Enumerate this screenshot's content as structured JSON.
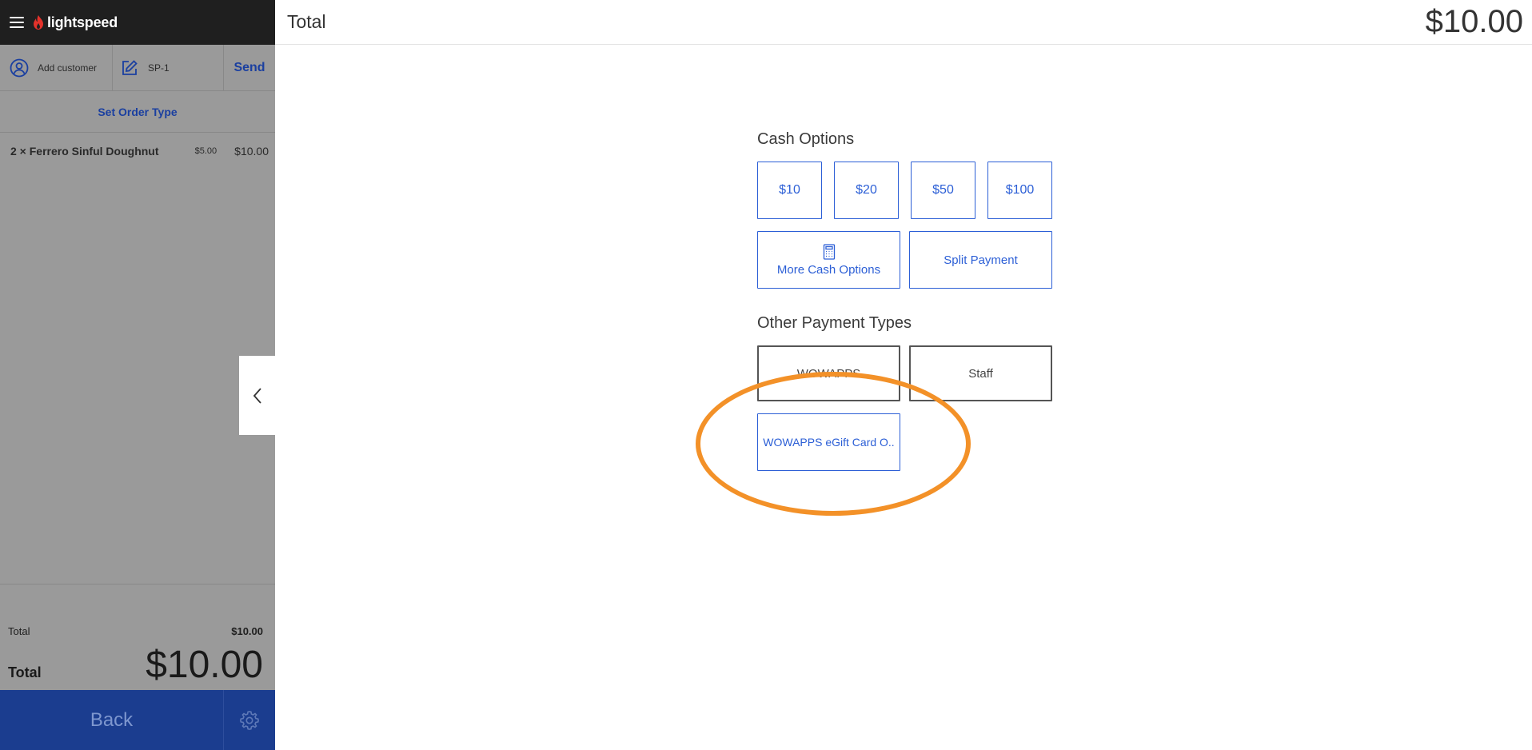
{
  "app": {
    "brand": "lightspeed"
  },
  "customer_bar": {
    "add_customer_label": "Add customer",
    "order_ref": "SP-1",
    "send_label": "Send"
  },
  "order_type_label": "Set Order Type",
  "line_items": [
    {
      "name": "2 × Ferrero Sinful Doughnut",
      "unit_price": "$5.00",
      "total": "$10.00"
    }
  ],
  "summary": {
    "subtotal_label": "Total",
    "subtotal_value": "$10.00",
    "total_label": "Total",
    "total_value": "$10.00"
  },
  "bottom": {
    "back_label": "Back",
    "settings_icon": "gear-icon"
  },
  "header": {
    "title": "Total",
    "amount": "$10.00"
  },
  "cash_options": {
    "title": "Cash Options",
    "quick_amounts": [
      "$10",
      "$20",
      "$50",
      "$100"
    ],
    "more_label": "More Cash Options",
    "split_label": "Split Payment"
  },
  "other_payment_types": {
    "title": "Other Payment Types",
    "buttons": [
      "WOWAPPS",
      "Staff",
      "WOWAPPS eGift Card O.."
    ]
  },
  "colors": {
    "accent": "#2c5fd6",
    "primary_dark": "#1b3d8f",
    "highlight": "#f39128",
    "sidebar_overlay": "#9a9a9a"
  }
}
